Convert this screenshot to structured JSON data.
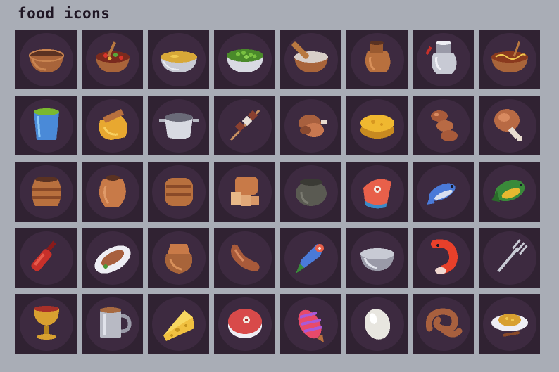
{
  "title": "food icons",
  "items": [
    {
      "icon": "empty-bowl-icon"
    },
    {
      "icon": "salad-bowl-icon"
    },
    {
      "icon": "soup-bowl-icon"
    },
    {
      "icon": "peas-bowl-icon"
    },
    {
      "icon": "mortar-pestle-icon"
    },
    {
      "icon": "clay-jug-icon"
    },
    {
      "icon": "milk-jug-icon"
    },
    {
      "icon": "noodle-bowl-icon"
    },
    {
      "icon": "drink-cup-icon"
    },
    {
      "icon": "grain-sack-icon"
    },
    {
      "icon": "cooking-pot-icon"
    },
    {
      "icon": "kebab-skewer-icon"
    },
    {
      "icon": "roasted-meat-icon"
    },
    {
      "icon": "cheese-wheel-icon"
    },
    {
      "icon": "sausage-links-icon"
    },
    {
      "icon": "drumstick-icon"
    },
    {
      "icon": "clay-pot-icon"
    },
    {
      "icon": "amphora-icon"
    },
    {
      "icon": "bread-loaf-icon"
    },
    {
      "icon": "sliced-bread-icon"
    },
    {
      "icon": "cauldron-icon"
    },
    {
      "icon": "salmon-steak-icon"
    },
    {
      "icon": "blue-fish-icon"
    },
    {
      "icon": "green-fish-icon"
    },
    {
      "icon": "wine-bottle-icon"
    },
    {
      "icon": "fish-platter-icon"
    },
    {
      "icon": "flour-sack-icon"
    },
    {
      "icon": "sausage-icon"
    },
    {
      "icon": "fish-tail-icon"
    },
    {
      "icon": "metal-bowl-icon"
    },
    {
      "icon": "shrimp-icon"
    },
    {
      "icon": "fork-icon"
    },
    {
      "icon": "goblet-icon"
    },
    {
      "icon": "tankard-icon"
    },
    {
      "icon": "cheese-wedge-icon"
    },
    {
      "icon": "tuna-steak-icon"
    },
    {
      "icon": "striped-fish-icon"
    },
    {
      "icon": "egg-icon"
    },
    {
      "icon": "pretzel-icon"
    },
    {
      "icon": "rice-plate-icon"
    }
  ],
  "colors": {
    "background": "#a9adb6",
    "tile": "#302232",
    "disc": "#3d2a40",
    "title": "#1f1624"
  }
}
